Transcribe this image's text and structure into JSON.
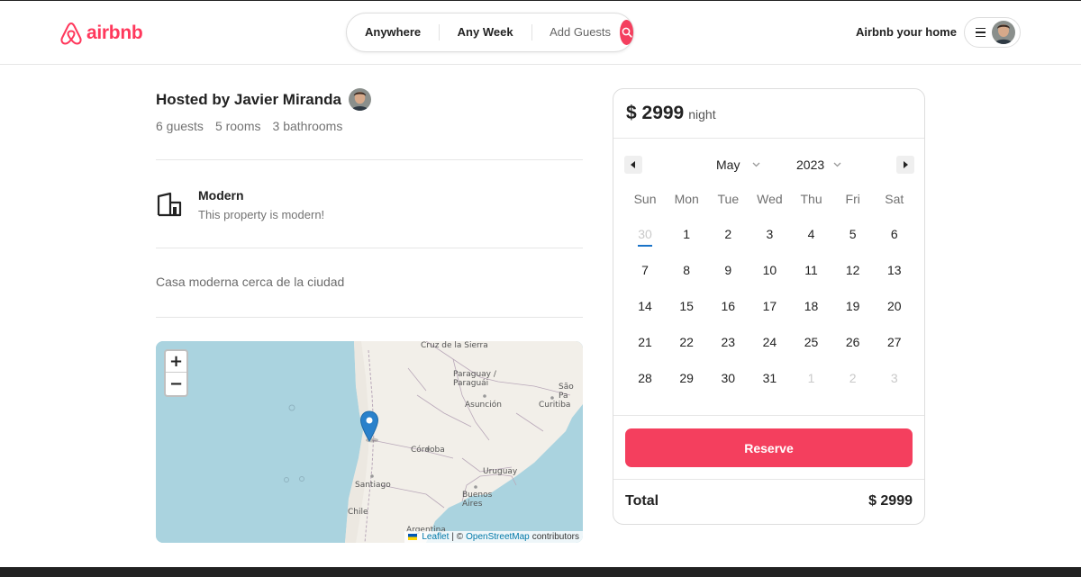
{
  "colors": {
    "brand": "#FF385C",
    "accent_button": "#F43F5E",
    "today_underline": "#1a73c8"
  },
  "header": {
    "logo_text": "airbnb",
    "search": {
      "location": "Anywhere",
      "week": "Any Week",
      "guests": "Add Guests",
      "icon": "search-icon"
    },
    "host_link": "Airbnb your home",
    "menu_icon": "hamburger-icon"
  },
  "listing": {
    "hosted_by": "Hosted by Javier Miranda",
    "stats": [
      "6 guests",
      "5 rooms",
      "3 bathrooms"
    ],
    "category": {
      "icon": "building-icon",
      "title": "Modern",
      "description": "This property is modern!"
    },
    "description": "Casa moderna cerca de la ciudad"
  },
  "map": {
    "zoom_in": "+",
    "zoom_out": "−",
    "labels": {
      "cruz": "Cruz de la Sierra",
      "paraguay": "Paraguay / Paraguái",
      "asuncion": "Asunción",
      "sao_paulo": "São Pa",
      "curitiba": "Curitiba",
      "cordoba": "Córdoba",
      "uruguay": "Uruguay",
      "santiago": "Santiago",
      "buenos_aires": "Buenos Aires",
      "chile": "Chile",
      "argentina": "Argentina"
    },
    "attribution": {
      "leaflet": "Leaflet",
      "separator": "| ©",
      "osm": "OpenStreetMap",
      "contributors": "contributors"
    }
  },
  "booking": {
    "price": "$ 2999",
    "per": "night",
    "calendar": {
      "month": "May",
      "year": "2023",
      "weekdays": [
        "Sun",
        "Mon",
        "Tue",
        "Wed",
        "Thu",
        "Fri",
        "Sat"
      ],
      "weeks": [
        [
          "30",
          "1",
          "2",
          "3",
          "4",
          "5",
          "6"
        ],
        [
          "7",
          "8",
          "9",
          "10",
          "11",
          "12",
          "13"
        ],
        [
          "14",
          "15",
          "16",
          "17",
          "18",
          "19",
          "20"
        ],
        [
          "21",
          "22",
          "23",
          "24",
          "25",
          "26",
          "27"
        ],
        [
          "28",
          "29",
          "30",
          "31",
          "1",
          "2",
          "3"
        ]
      ]
    },
    "reserve_label": "Reserve",
    "total_label": "Total",
    "total_value": "$ 2999"
  }
}
